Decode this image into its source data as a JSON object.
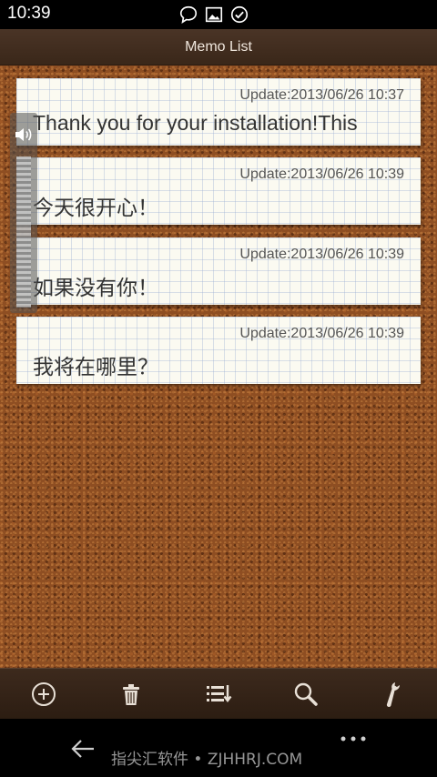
{
  "status_bar": {
    "time": "10:39",
    "icons": [
      "chat-icon",
      "image-icon",
      "check-circle-icon"
    ]
  },
  "title_bar": {
    "title": "Memo List"
  },
  "memos": [
    {
      "date": "Update:2013/06/26 10:37",
      "text": "Thank you for your installation!This"
    },
    {
      "date": "Update:2013/06/26 10:39",
      "text": "今天很开心！"
    },
    {
      "date": "Update:2013/06/26 10:39",
      "text": "如果没有你！"
    },
    {
      "date": "Update:2013/06/26 10:39",
      "text": "我将在哪里？"
    }
  ],
  "toolbar": {
    "buttons": [
      "add-icon",
      "trash-icon",
      "sort-list-icon",
      "search-icon",
      "wrench-icon"
    ]
  },
  "nav_bar": {
    "watermark": "指尖汇软件 • ZJHHRJ.COM"
  },
  "colors": {
    "cork": "#8e4e22",
    "bar_brown": "#3d2a1d",
    "memo_paper": "#fbfaf1",
    "grid_line": "#96aad2"
  }
}
